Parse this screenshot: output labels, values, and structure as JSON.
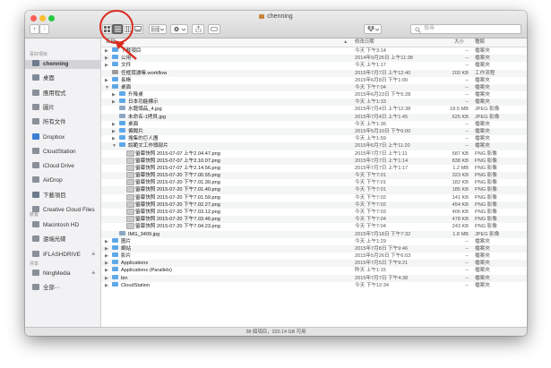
{
  "window": {
    "title": "chenning"
  },
  "toolbar": {
    "back": "‹",
    "forward": "›",
    "search_placeholder": "搜尋"
  },
  "sidebar": {
    "fav_header": "喜好項目",
    "favorites": [
      {
        "label": "chenning",
        "icon": "home-icon",
        "selected": true
      },
      {
        "label": "桌面",
        "icon": "desktop-icon"
      },
      {
        "label": "應用程式",
        "icon": "applications-icon"
      },
      {
        "label": "圖片",
        "icon": "pictures-icon"
      },
      {
        "label": "所有文件",
        "icon": "all-files-icon"
      },
      {
        "label": "Dropbox",
        "icon": "dropbox-icon"
      },
      {
        "label": "CloudStation",
        "icon": "folder-icon"
      },
      {
        "label": "iCloud Drive",
        "icon": "cloud-icon"
      },
      {
        "label": "AirDrop",
        "icon": "airdrop-icon"
      },
      {
        "label": "下載項目",
        "icon": "downloads-icon"
      },
      {
        "label": "Creative Cloud Files",
        "icon": "creative-cloud-icon"
      }
    ],
    "dev_header": "裝置",
    "devices": [
      {
        "label": "Macintosh HD",
        "icon": "disk-icon"
      },
      {
        "label": "遠端光碟",
        "icon": "remote-disc-icon"
      },
      {
        "label": "IFLASHDRIVE",
        "icon": "drive-icon",
        "eject": "≜"
      }
    ],
    "share_header": "共享",
    "shared": [
      {
        "label": "NingMedia",
        "icon": "server-icon",
        "eject": "≜"
      },
      {
        "label": "全部⋯",
        "icon": "network-icon"
      }
    ]
  },
  "columns": {
    "name": "名稱",
    "date": "修改日期",
    "size": "大小",
    "kind": "種類"
  },
  "rows": [
    {
      "indent": 0,
      "tri": "▶",
      "type": "folder",
      "name": "下載項目",
      "date": "今天 下午3:14",
      "size": "--",
      "kind": "檔案夾"
    },
    {
      "indent": 0,
      "tri": "▶",
      "type": "folder",
      "name": "公用",
      "date": "2014年9月26日 上午11:38",
      "size": "--",
      "kind": "檔案夾"
    },
    {
      "indent": 0,
      "tri": "▶",
      "type": "folder",
      "name": "文件",
      "date": "今天 上午1:17",
      "size": "--",
      "kind": "檔案夾"
    },
    {
      "indent": 0,
      "tri": "",
      "type": "workflow",
      "name": "任框窩濾嘛.workflow",
      "date": "2015年7月7日 上午12:40",
      "size": "200 KB",
      "kind": "工作流程"
    },
    {
      "indent": 0,
      "tri": "▶",
      "type": "folder",
      "name": "長帳",
      "date": "2015年6月8日 下午1:00",
      "size": "--",
      "kind": "檔案夾"
    },
    {
      "indent": 0,
      "tri": "▼",
      "type": "folder",
      "name": "桌面",
      "date": "今天 下午7:04",
      "size": "--",
      "kind": "檔案夾"
    },
    {
      "indent": 1,
      "tri": "▶",
      "type": "folder",
      "name": "升降桌",
      "date": "2015年6月23日 下午5:28",
      "size": "--",
      "kind": "檔案夾"
    },
    {
      "indent": 1,
      "tri": "▶",
      "type": "folder",
      "name": "日本功能標示",
      "date": "今天 上午1:33",
      "size": "--",
      "kind": "檔案夾"
    },
    {
      "indent": 1,
      "tri": "",
      "type": "image",
      "name": "水龍頭品_4.jpg",
      "date": "2015年7月4日 上午12:38",
      "size": "18.5 MB",
      "kind": "JPEG 影像"
    },
    {
      "indent": 1,
      "tri": "",
      "type": "image",
      "name": "未命名-1拷貝.jpg",
      "date": "2015年7月4日 上午1:45",
      "size": "625 KB",
      "kind": "JPEG 影像"
    },
    {
      "indent": 1,
      "tri": "▶",
      "type": "folder",
      "name": "桌面",
      "date": "今天 上午1:36",
      "size": "--",
      "kind": "檔案夾"
    },
    {
      "indent": 1,
      "tri": "▶",
      "type": "folder",
      "name": "偏聞片",
      "date": "2015年5月10日 下午6:00",
      "size": "--",
      "kind": "檔案夾"
    },
    {
      "indent": 1,
      "tri": "▶",
      "type": "folder",
      "name": "搜集的巨人團",
      "date": "今天 上午1:59",
      "size": "--",
      "kind": "檔案夾"
    },
    {
      "indent": 1,
      "tri": "▼",
      "type": "folder",
      "name": "說範文工作頭部片",
      "date": "2015年6月7日 上午11:20",
      "size": "--",
      "kind": "檔案夾"
    },
    {
      "indent": 2,
      "tri": "",
      "type": "png",
      "name": "螢幕快照 2015-07-07 上午2.04.47.png",
      "date": "2015年7月7日 上午1:11",
      "size": "587 KB",
      "kind": "PNG 影像"
    },
    {
      "indent": 2,
      "tri": "",
      "type": "png",
      "name": "螢幕快照 2015-07-07 上午2.10.07.png",
      "date": "2015年7月7日 上午1:14",
      "size": "838 KB",
      "kind": "PNG 影像"
    },
    {
      "indent": 2,
      "tri": "",
      "type": "png",
      "name": "螢幕快照 2015-07-07 上午2.14.56.png",
      "date": "2015年7月7日 上午1:17",
      "size": "1.2 MB",
      "kind": "PNG 影像"
    },
    {
      "indent": 2,
      "tri": "",
      "type": "png",
      "name": "螢幕快照 2015-07-20 下午7.00.55.png",
      "date": "今天 下午7:01",
      "size": "323 KB",
      "kind": "PNG 影像"
    },
    {
      "indent": 2,
      "tri": "",
      "type": "png",
      "name": "螢幕快照 2015-07-20 下午7.01.30.png",
      "date": "今天 下午7:01",
      "size": "182 KB",
      "kind": "PNG 影像"
    },
    {
      "indent": 2,
      "tri": "",
      "type": "png",
      "name": "螢幕快照 2015-07-20 下午7.01.40.png",
      "date": "今天 下午7:01",
      "size": "185 KB",
      "kind": "PNG 影像"
    },
    {
      "indent": 2,
      "tri": "",
      "type": "png",
      "name": "螢幕快照 2015-07-20 下午7.01.59.png",
      "date": "今天 下午7:02",
      "size": "141 KB",
      "kind": "PNG 影像"
    },
    {
      "indent": 2,
      "tri": "",
      "type": "png",
      "name": "螢幕快照 2015-07-20 下午7.02.27.png",
      "date": "今天 下午7:02",
      "size": "454 KB",
      "kind": "PNG 影像"
    },
    {
      "indent": 2,
      "tri": "",
      "type": "png",
      "name": "螢幕快照 2015-07-20 下午7.03.12.png",
      "date": "今天 下午7:03",
      "size": "406 KB",
      "kind": "PNG 影像"
    },
    {
      "indent": 2,
      "tri": "",
      "type": "png",
      "name": "螢幕快照 2015-07-20 下午7.03.46.png",
      "date": "今天 下午7:04",
      "size": "478 KB",
      "kind": "PNG 影像"
    },
    {
      "indent": 2,
      "tri": "",
      "type": "png",
      "name": "螢幕快照 2015-07-20 下午7.04.23.png",
      "date": "今天 下午7:04",
      "size": "243 KB",
      "kind": "PNG 影像"
    },
    {
      "indent": 1,
      "tri": "",
      "type": "image",
      "name": "IMG_3409.jpg",
      "date": "2015年7月18日 下午7:32",
      "size": "1.8 MB",
      "kind": "JPEG 影像"
    },
    {
      "indent": 0,
      "tri": "▶",
      "type": "folder",
      "name": "圖片",
      "date": "今天 上午1:29",
      "size": "--",
      "kind": "檔案夾"
    },
    {
      "indent": 0,
      "tri": "▶",
      "type": "folder",
      "name": "網站",
      "date": "2015年7月8日 下午9:46",
      "size": "--",
      "kind": "檔案夾"
    },
    {
      "indent": 0,
      "tri": "▶",
      "type": "folder",
      "name": "影片",
      "date": "2015年5月26日 下午6:03",
      "size": "--",
      "kind": "檔案夾"
    },
    {
      "indent": 0,
      "tri": "▶",
      "type": "folder",
      "name": "Applications",
      "date": "2015年7月5日 下午9:21",
      "size": "--",
      "kind": "檔案夾"
    },
    {
      "indent": 0,
      "tri": "▶",
      "type": "folder",
      "name": "Applications (Parallels)",
      "date": "昨天 上午1:15",
      "size": "--",
      "kind": "檔案夾"
    },
    {
      "indent": 0,
      "tri": "▶",
      "type": "folder",
      "name": "bin",
      "date": "2015年7月7日 下午4:38",
      "size": "--",
      "kind": "檔案夾"
    },
    {
      "indent": 0,
      "tri": "▶",
      "type": "folder",
      "name": "CloudStation",
      "date": "今天 下午12:34",
      "size": "--",
      "kind": "檔案夾"
    }
  ],
  "status": "38 個項目，320.14 GB 可用",
  "colors": {
    "accent": "#3a8ee6",
    "folder": "#5fa8e8",
    "annotation": "#d92b1f",
    "close": "#fc5f57",
    "minimize": "#fdbd2e",
    "zoom": "#28c941"
  }
}
